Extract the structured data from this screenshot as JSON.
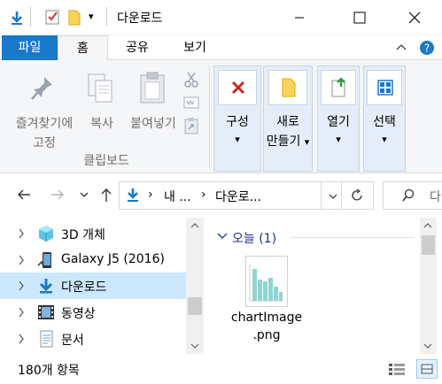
{
  "window": {
    "title": "다운로드"
  },
  "ribbon_tabs": [
    {
      "label": "파일"
    },
    {
      "label": "홈"
    },
    {
      "label": "공유"
    },
    {
      "label": "보기"
    }
  ],
  "clipboard": {
    "pin_label_line1": "즐겨찾기에",
    "pin_label_line2": "고정",
    "copy_label": "복사",
    "paste_label": "붙여넣기",
    "group_label": "클립보드"
  },
  "organize": {
    "label": "구성",
    "arrow": "▾"
  },
  "new": {
    "label_line1": "새로",
    "label_line2": "만들기",
    "arrow": "▾"
  },
  "open": {
    "label": "열기",
    "arrow": "▾"
  },
  "select": {
    "label": "선택",
    "arrow": "▾"
  },
  "address": {
    "crumb1": "내 ...",
    "crumb2": "다운로...",
    "sep": "›"
  },
  "search": {
    "placeholder": "다"
  },
  "nav_items": [
    {
      "label": "3D 개체"
    },
    {
      "label": "Galaxy J5 (2016)"
    },
    {
      "label": "다운로드"
    },
    {
      "label": "동영상"
    },
    {
      "label": "문서"
    }
  ],
  "content": {
    "group_header": "오늘 (1)",
    "file_name_line1": "chartImage",
    "file_name_line2": ".png"
  },
  "status": {
    "item_count": "180개 항목"
  },
  "colors": {
    "accent": "#1979ca",
    "selected": "#cce8ff",
    "ribbon_bg": "#f5f6f7",
    "group_bg": "#e5eef8"
  }
}
